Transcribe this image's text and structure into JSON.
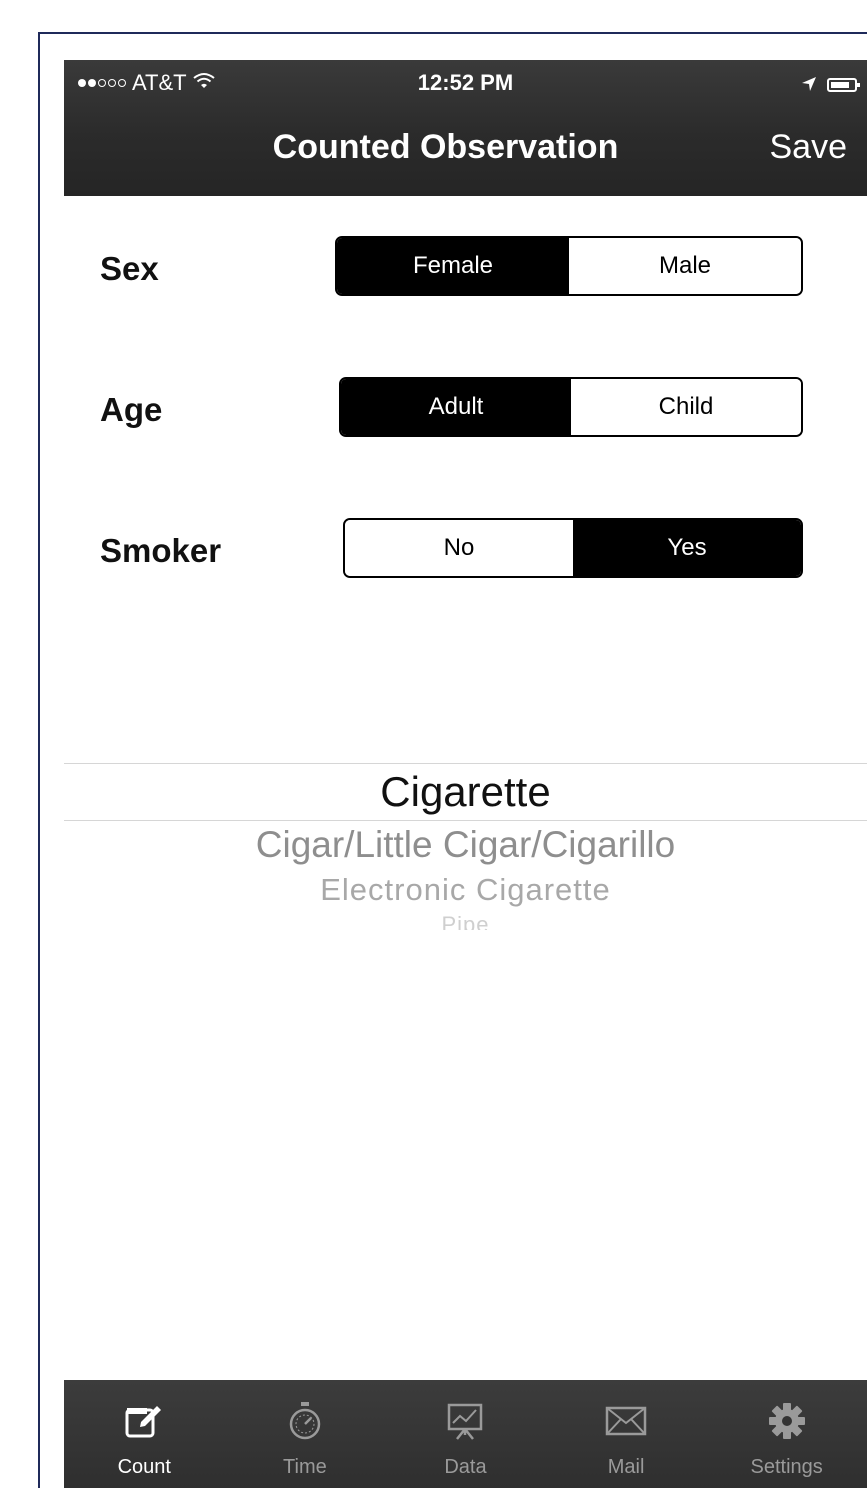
{
  "status_bar": {
    "carrier": "AT&T",
    "time": "12:52 PM"
  },
  "nav": {
    "title": "Counted Observation",
    "save_label": "Save"
  },
  "form": {
    "sex": {
      "label": "Sex",
      "options": [
        "Female",
        "Male"
      ],
      "selected": "Female"
    },
    "age": {
      "label": "Age",
      "options": [
        "Adult",
        "Child"
      ],
      "selected": "Adult"
    },
    "smoker": {
      "label": "Smoker",
      "options": [
        "No",
        "Yes"
      ],
      "selected": "Yes"
    }
  },
  "picker": {
    "selected": "Cigarette",
    "items": [
      "Cigarette",
      "Cigar/Little Cigar/Cigarillo",
      "Electronic Cigarette",
      "Pipe"
    ]
  },
  "tab_bar": {
    "active": "Count",
    "tabs": [
      {
        "label": "Count",
        "icon": "edit-icon"
      },
      {
        "label": "Time",
        "icon": "stopwatch-icon"
      },
      {
        "label": "Data",
        "icon": "chart-icon"
      },
      {
        "label": "Mail",
        "icon": "mail-icon"
      },
      {
        "label": "Settings",
        "icon": "gear-icon"
      }
    ]
  },
  "colors": {
    "bar_background": "#2b2b2b",
    "frame_border": "#1f2a5a",
    "selected_segment": "#000000"
  }
}
